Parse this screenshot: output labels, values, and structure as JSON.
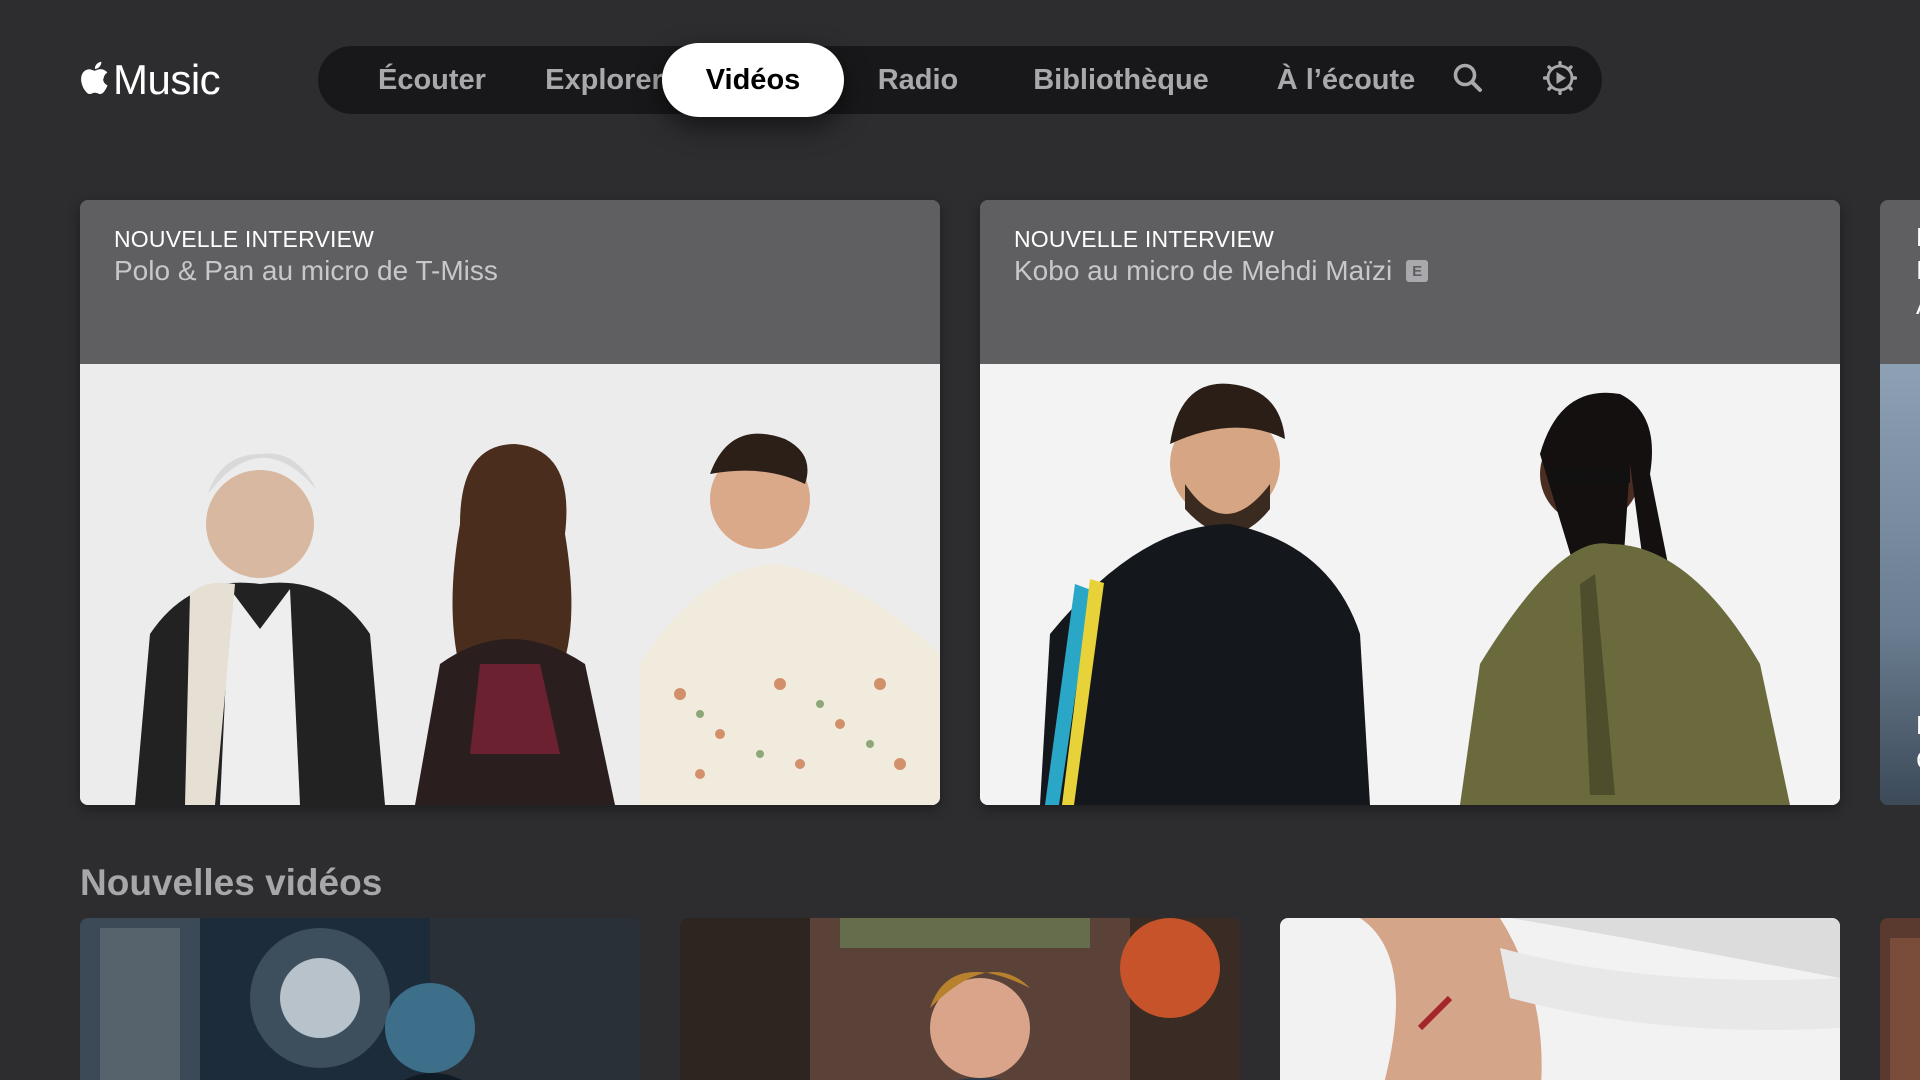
{
  "app": {
    "logo_text": "Music"
  },
  "nav": {
    "items": [
      {
        "label": "Écouter",
        "active": false
      },
      {
        "label": "Explorer",
        "active": false
      },
      {
        "label": "Vidéos",
        "active": true
      },
      {
        "label": "Radio",
        "active": false
      },
      {
        "label": "Bibliothèque",
        "active": false
      },
      {
        "label": "À l’écoute",
        "active": false
      }
    ],
    "icons": [
      "search-icon",
      "settings-gear-icon"
    ]
  },
  "hero": {
    "cards": [
      {
        "eyebrow": "NOUVELLE INTERVIEW",
        "title": "Polo & Pan au micro de T-Miss",
        "explicit": false
      },
      {
        "eyebrow": "NOUVELLE INTERVIEW",
        "title": "Kobo au micro de Mehdi Maïzi",
        "explicit": true,
        "explicit_label": "E"
      }
    ],
    "peek_chars": [
      "F",
      "I",
      "A",
      "F",
      "C"
    ]
  },
  "section": {
    "title": "Nouvelles vidéos"
  },
  "colors": {
    "background": "#2d2d30",
    "nav_background": "#18181a",
    "nav_text": "#a9a9ad",
    "nav_active_bg": "#ffffff",
    "section_title": "#a7a7ab"
  }
}
